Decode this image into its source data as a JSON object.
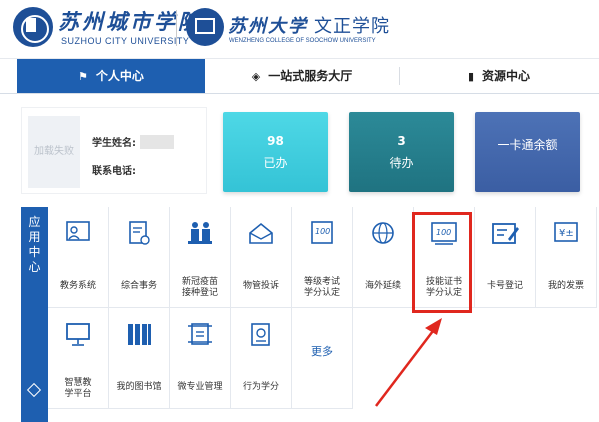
{
  "header": {
    "brand1": "苏州城市学院",
    "brand1_en": "SUZHOU CITY UNIVERSITY",
    "brand2_a": "苏州大学",
    "brand2_b": "文正学院",
    "brand2_en": "WENZHENG COLLEGE OF SOOCHOW UNIVERSITY"
  },
  "nav": {
    "tabs": [
      {
        "label": "个人中心",
        "icon": "user-icon",
        "active": true
      },
      {
        "label": "一站式服务大厅",
        "icon": "layers-icon",
        "active": false
      },
      {
        "label": "资源中心",
        "icon": "book-icon",
        "active": false
      }
    ]
  },
  "profile": {
    "avatar_text": "加载失败",
    "name_label": "学生姓名:",
    "phone_label": "联系电话:"
  },
  "stats": [
    {
      "value": "98",
      "label": "已办"
    },
    {
      "value": "3",
      "label": "待办"
    },
    {
      "value": "",
      "label": "一卡通余额"
    }
  ],
  "apps": {
    "sidebar_title": "应用中心",
    "items": [
      {
        "label": "教务系统",
        "icon": "teacher-board-icon"
      },
      {
        "label": "综合事务",
        "icon": "document-gear-icon"
      },
      {
        "label": "新冠疫苗接种登记",
        "icon": "vaccination-icon"
      },
      {
        "label": "物管投诉",
        "icon": "envelope-icon"
      },
      {
        "label": "等级考试学分认定",
        "icon": "score-100-icon"
      },
      {
        "label": "海外延续",
        "icon": "globe-icon"
      },
      {
        "label": "技能证书学分认定",
        "icon": "certificate-100-icon"
      },
      {
        "label": "卡号登记",
        "icon": "edit-card-icon"
      },
      {
        "label": "我的发票",
        "icon": "invoice-icon"
      },
      {
        "label": "智慧教学平台",
        "icon": "monitor-icon"
      },
      {
        "label": "我的图书馆",
        "icon": "books-icon"
      },
      {
        "label": "微专业管理",
        "icon": "scroll-icon"
      },
      {
        "label": "行为学分",
        "icon": "clipboard-icon"
      },
      {
        "label": "更多",
        "icon": ""
      }
    ]
  },
  "colors": {
    "primary": "#1e5fb0",
    "highlight": "#e0271e"
  }
}
